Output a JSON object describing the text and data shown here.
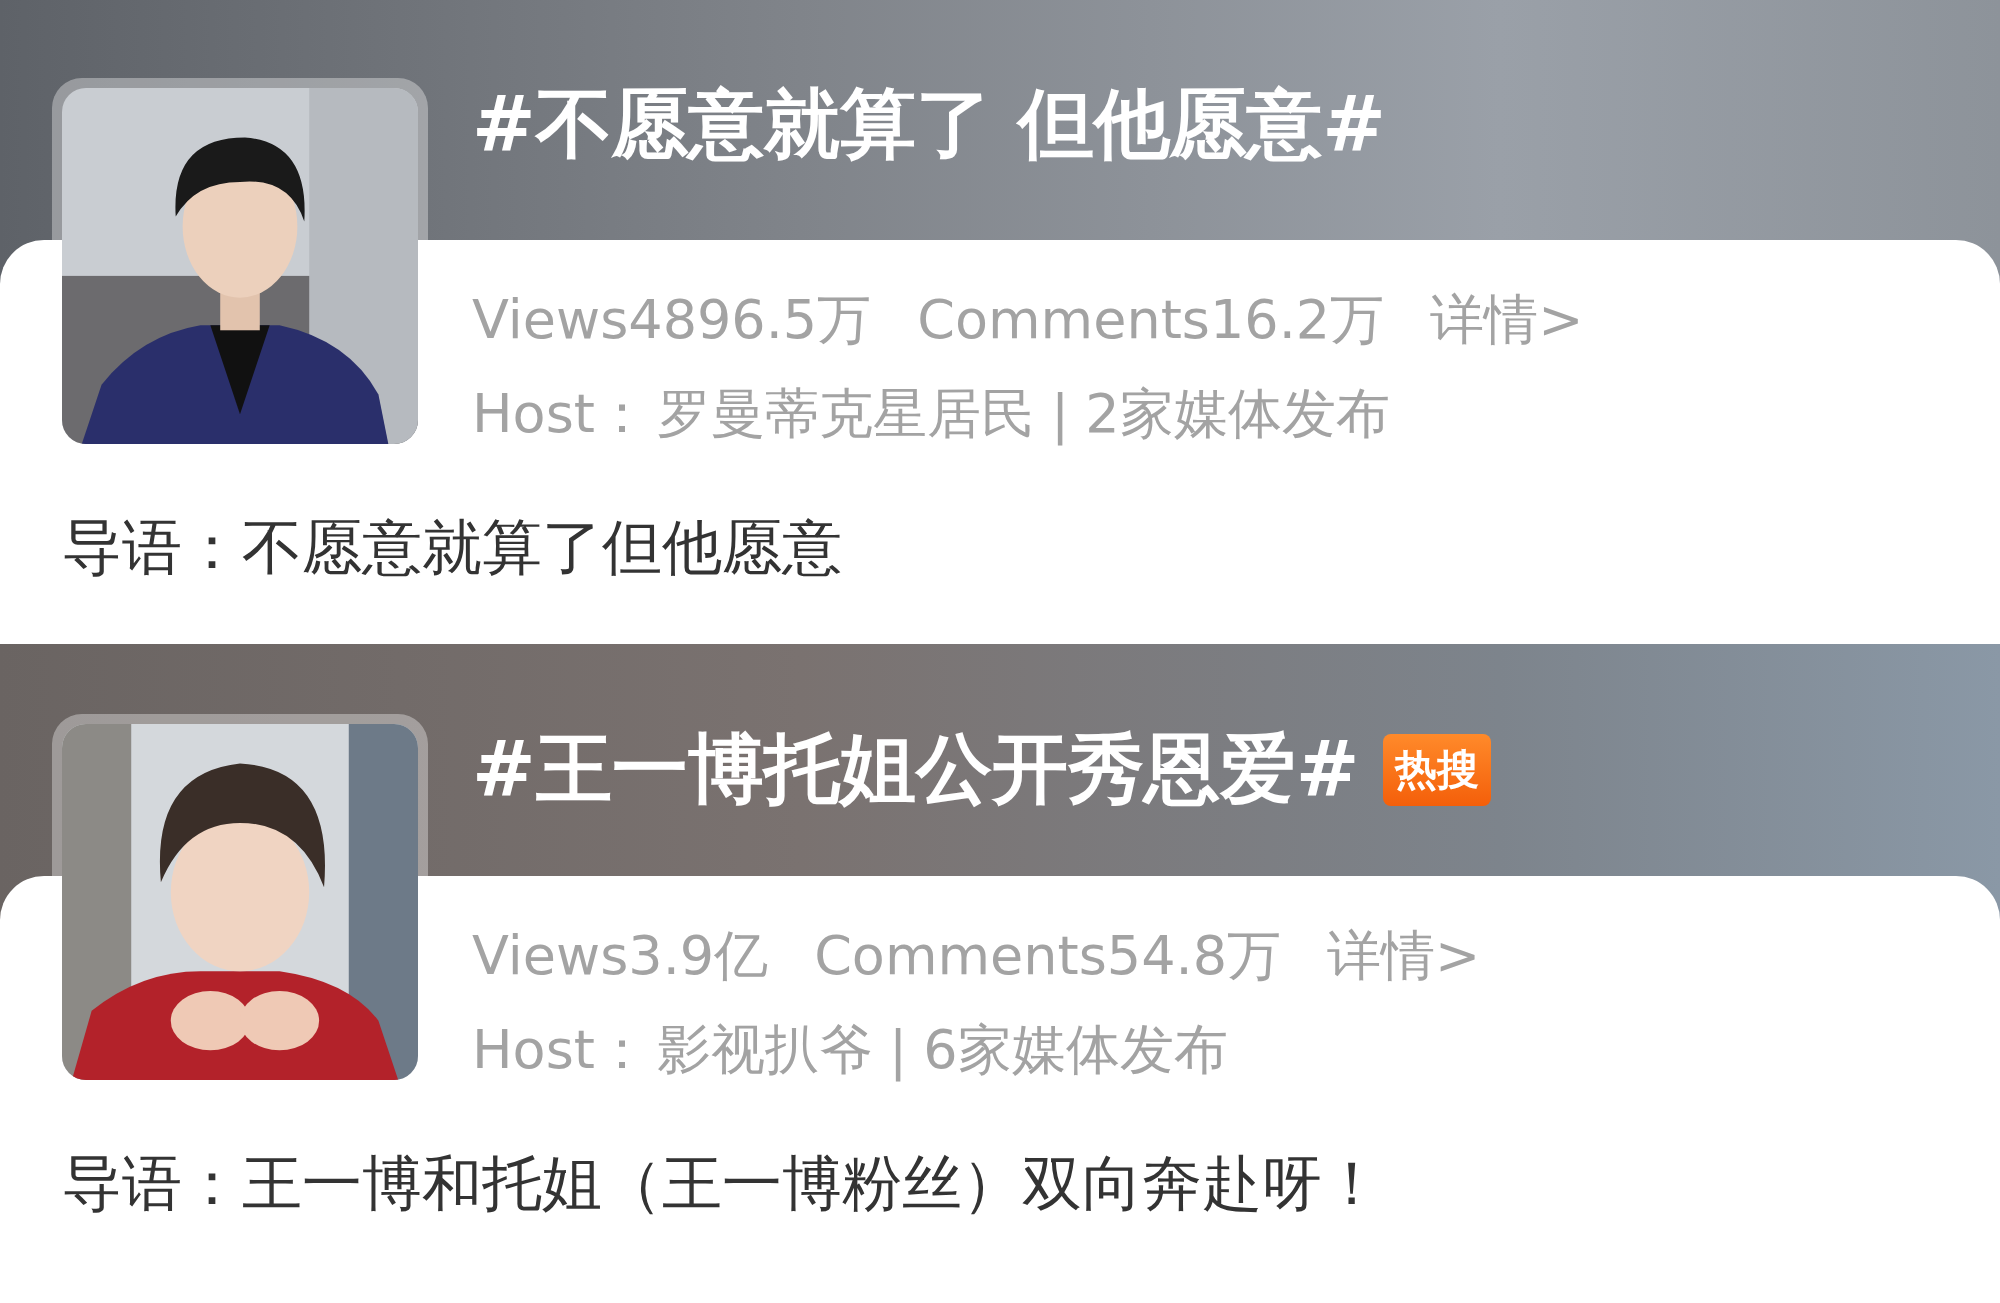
{
  "topics": [
    {
      "title": "#不愿意就算了 但他愿意#",
      "views": "Views4896.5万",
      "comments": "Comments16.2万",
      "detail": "详情>",
      "host_label": "Host：",
      "host": "罗曼蒂克星居民",
      "separator": "|",
      "media": "2家媒体发布",
      "lead": "导语：不愿意就算了但他愿意"
    },
    {
      "title": "#王一博托姐公开秀恩爱#",
      "badge": "热搜",
      "views": "Views3.9亿",
      "comments": "Comments54.8万",
      "detail": "详情>",
      "host_label": "Host：",
      "host": "影视扒爷",
      "separator": "|",
      "media": "6家媒体发布",
      "lead": "导语：王一博和托姐（王一博粉丝）双向奔赴呀！"
    }
  ]
}
